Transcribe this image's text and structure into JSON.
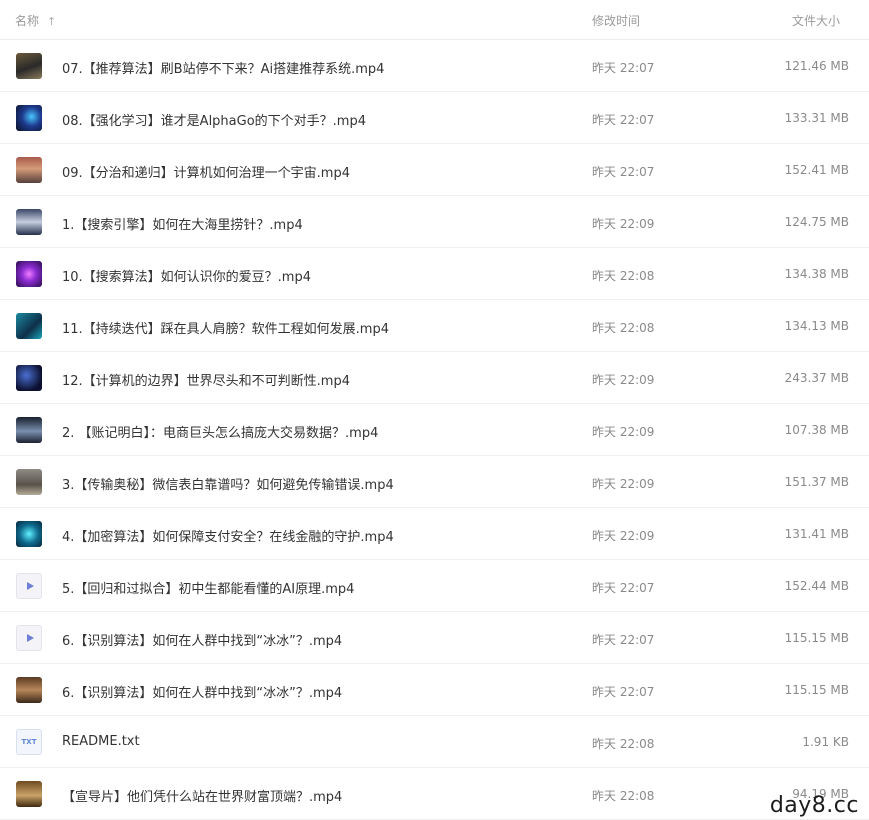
{
  "header": {
    "name_label": "名称",
    "sort_icon": "arrow-up-icon",
    "modified_label": "修改时间",
    "size_label": "文件大小"
  },
  "files": [
    {
      "name": "07.【推荐算法】刷B站停不下来？Ai搭建推荐系统.mp4",
      "modified": "昨天 22:07",
      "size": "121.46 MB",
      "thumb": "bg-dark-land",
      "icon": "video-thumbnail-icon"
    },
    {
      "name": "08.【强化学习】谁才是AlphaGo的下个对手？.mp4",
      "modified": "昨天 22:07",
      "size": "133.31 MB",
      "thumb": "bg-blue-robot",
      "icon": "video-thumbnail-icon"
    },
    {
      "name": "09.【分治和递归】计算机如何治理一个宇宙.mp4",
      "modified": "昨天 22:07",
      "size": "152.41 MB",
      "thumb": "bg-people",
      "icon": "video-thumbnail-icon"
    },
    {
      "name": "1.【搜索引擎】如何在大海里捞针？.mp4",
      "modified": "昨天 22:09",
      "size": "124.75 MB",
      "thumb": "bg-city",
      "icon": "video-thumbnail-icon"
    },
    {
      "name": "10.【搜索算法】如何认识你的爱豆？.mp4",
      "modified": "昨天 22:08",
      "size": "134.38 MB",
      "thumb": "bg-purple",
      "icon": "video-thumbnail-icon"
    },
    {
      "name": "11.【持续迭代】踩在具人肩膀？软件工程如何发展.mp4",
      "modified": "昨天 22:08",
      "size": "134.13 MB",
      "thumb": "bg-teal",
      "icon": "video-thumbnail-icon"
    },
    {
      "name": "12.【计算机的边界】世界尽头和不可判断性.mp4",
      "modified": "昨天 22:09",
      "size": "243.37 MB",
      "thumb": "bg-night",
      "icon": "video-thumbnail-icon"
    },
    {
      "name": "2. 【账记明白】：电商巨头怎么搞庞大交易数据？.mp4",
      "modified": "昨天 22:09",
      "size": "107.38 MB",
      "thumb": "bg-cars",
      "icon": "video-thumbnail-icon"
    },
    {
      "name": "3.【传输奥秘】微信表白靠谱吗？如何避免传输错误.mp4",
      "modified": "昨天 22:09",
      "size": "151.37 MB",
      "thumb": "bg-stone",
      "icon": "video-thumbnail-icon"
    },
    {
      "name": "4.【加密算法】如何保障支付安全？在线金融的守护.mp4",
      "modified": "昨天 22:09",
      "size": "131.41 MB",
      "thumb": "bg-cyan-net",
      "icon": "video-thumbnail-icon"
    },
    {
      "name": "5.【回归和过拟合】初中生都能看懂的AI原理.mp4",
      "modified": "昨天 22:07",
      "size": "152.44 MB",
      "thumb": "play",
      "icon": "video-file-icon"
    },
    {
      "name": "6.【识别算法】如何在人群中找到“冰冰”？.mp4",
      "modified": "昨天 22:07",
      "size": "115.15 MB",
      "thumb": "play",
      "icon": "video-file-icon"
    },
    {
      "name": "6.【识别算法】如何在人群中找到“冰冰”？.mp4",
      "modified": "昨天 22:07",
      "size": "115.15 MB",
      "thumb": "bg-crowd",
      "icon": "video-thumbnail-icon"
    },
    {
      "name": "README.txt",
      "modified": "昨天 22:08",
      "size": "1.91 KB",
      "thumb": "txt",
      "icon": "txt-file-icon",
      "thumb_text": "TXT"
    },
    {
      "name": "【宣导片】他们凭什么站在世界财富顶端？.mp4",
      "modified": "昨天 22:08",
      "size": "94.19 MB",
      "thumb": "bg-portrait",
      "icon": "video-thumbnail-icon"
    }
  ],
  "watermark": "day8.cc"
}
